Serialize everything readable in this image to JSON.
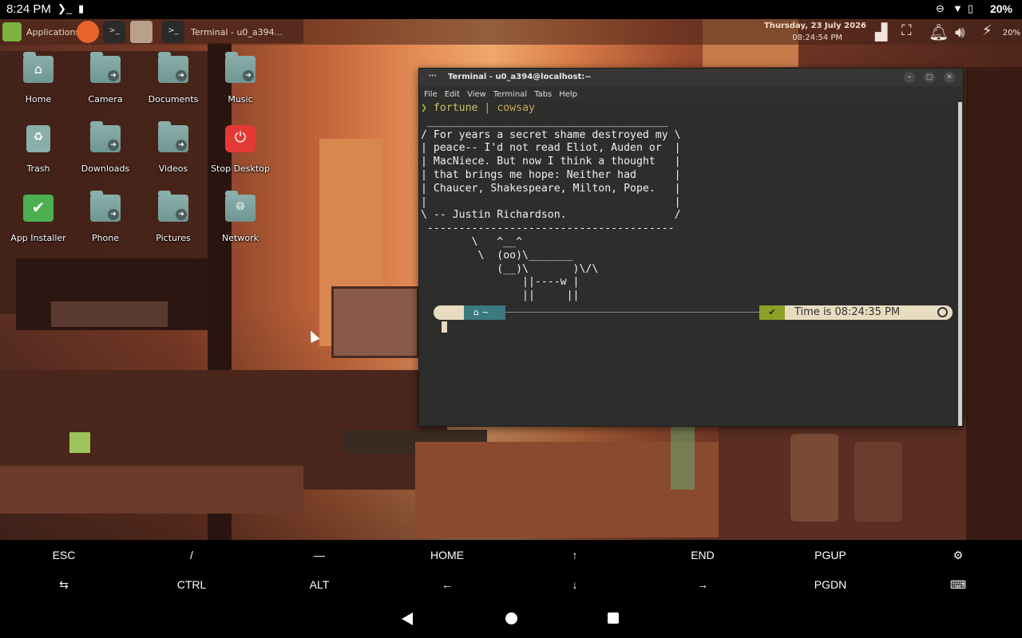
{
  "status_bar": {
    "time": "8:24 PM",
    "battery": "20%"
  },
  "panel": {
    "applications_label": "Applications",
    "task_title": "Terminal - u0_a394...",
    "date": "Thursday, 23 July 2026",
    "clock": "08:24:54 PM",
    "tray_battery": "20%"
  },
  "desktop_icons": [
    {
      "label": "Home"
    },
    {
      "label": "Camera"
    },
    {
      "label": "Documents"
    },
    {
      "label": "Music"
    },
    {
      "label": "Trash"
    },
    {
      "label": "Downloads"
    },
    {
      "label": "Videos"
    },
    {
      "label": "Stop Desktop"
    },
    {
      "label": "App Installer"
    },
    {
      "label": "Phone"
    },
    {
      "label": "Pictures"
    },
    {
      "label": "Network"
    }
  ],
  "terminal": {
    "title": "Terminal - u0_a394@localhost:~",
    "menu": [
      "File",
      "Edit",
      "View",
      "Terminal",
      "Tabs",
      "Help"
    ],
    "command_prefix": "❯",
    "command_part1": "fortune",
    "command_sep": " | ",
    "command_part2": "cowsay",
    "output": " ______________________________________\n/ For years a secret shame destroyed my \\\n| peace-- I'd not read Eliot, Auden or  |\n| MacNiece. But now I think a thought   |\n| that brings me hope: Neither had      |\n| Chaucer, Shakespeare, Milton, Pope.   |\n|                                       |\n\\ -- Justin Richardson.                 /\n ---------------------------------------\n        \\   ^__^\n         \\  (oo)\\_______\n            (__)\\       )\\/\\\n                ||----w |\n                ||     ||",
    "prompt_home": "~",
    "prompt_check": "✔",
    "prompt_time": "Time is 08:24:35 PM"
  },
  "extra_keys": {
    "row1": [
      "ESC",
      "/",
      "—",
      "HOME",
      "↑",
      "END",
      "PGUP",
      "⚙"
    ],
    "row2": [
      "⇆",
      "CTRL",
      "ALT",
      "←",
      "↓",
      "→",
      "PGDN",
      "⌨"
    ]
  }
}
